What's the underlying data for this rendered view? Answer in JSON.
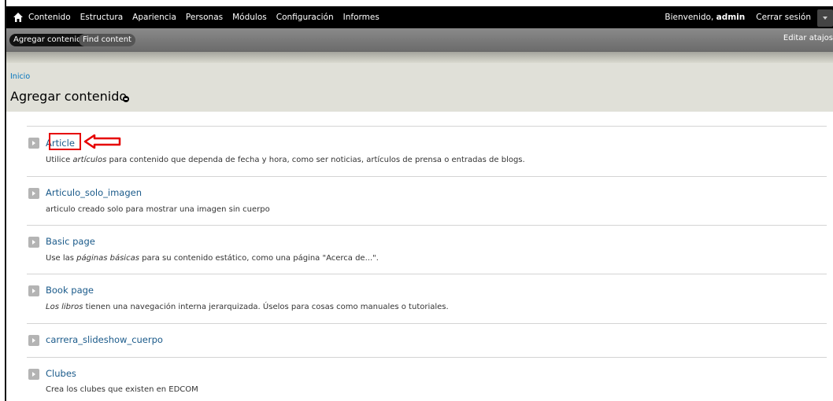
{
  "toolbar": {
    "menu": [
      "Contenido",
      "Estructura",
      "Apariencia",
      "Personas",
      "Módulos",
      "Configuración",
      "Informes"
    ],
    "welcome_prefix": "Bienvenido, ",
    "welcome_user": "admin",
    "logout": "Cerrar sesión"
  },
  "shortcuts": {
    "active": "Agregar contenido",
    "find": "Find content",
    "edit": "Editar atajos"
  },
  "header": {
    "breadcrumb": "Inicio",
    "title": "Agregar contenido"
  },
  "content_types": [
    {
      "name": "Article",
      "desc_parts": [
        "Utilice ",
        "artículos",
        " para contenido que dependa de fecha y hora, como ser noticias, artículos de prensa o entradas de blogs."
      ]
    },
    {
      "name": "Articulo_solo_imagen",
      "desc_parts": [
        "articulo creado solo para mostrar una imagen sin cuerpo",
        "",
        ""
      ]
    },
    {
      "name": "Basic page",
      "desc_parts": [
        "Use las ",
        "páginas básicas",
        " para su contenido estático, como una página \"Acerca de...\"."
      ]
    },
    {
      "name": "Book page",
      "desc_parts": [
        "",
        "Los libros",
        " tienen una navegación interna jerarquizada. Úselos para cosas como manuales o tutoriales."
      ]
    },
    {
      "name": "carrera_slideshow_cuerpo",
      "desc_parts": [
        "",
        "",
        ""
      ]
    },
    {
      "name": "Clubes",
      "desc_parts": [
        "Crea los clubes que existen en EDCOM",
        "",
        ""
      ]
    }
  ],
  "colors": {
    "toolbar_bg": "#000000",
    "link": "#1a5a8a",
    "highlight": "#e60000"
  }
}
